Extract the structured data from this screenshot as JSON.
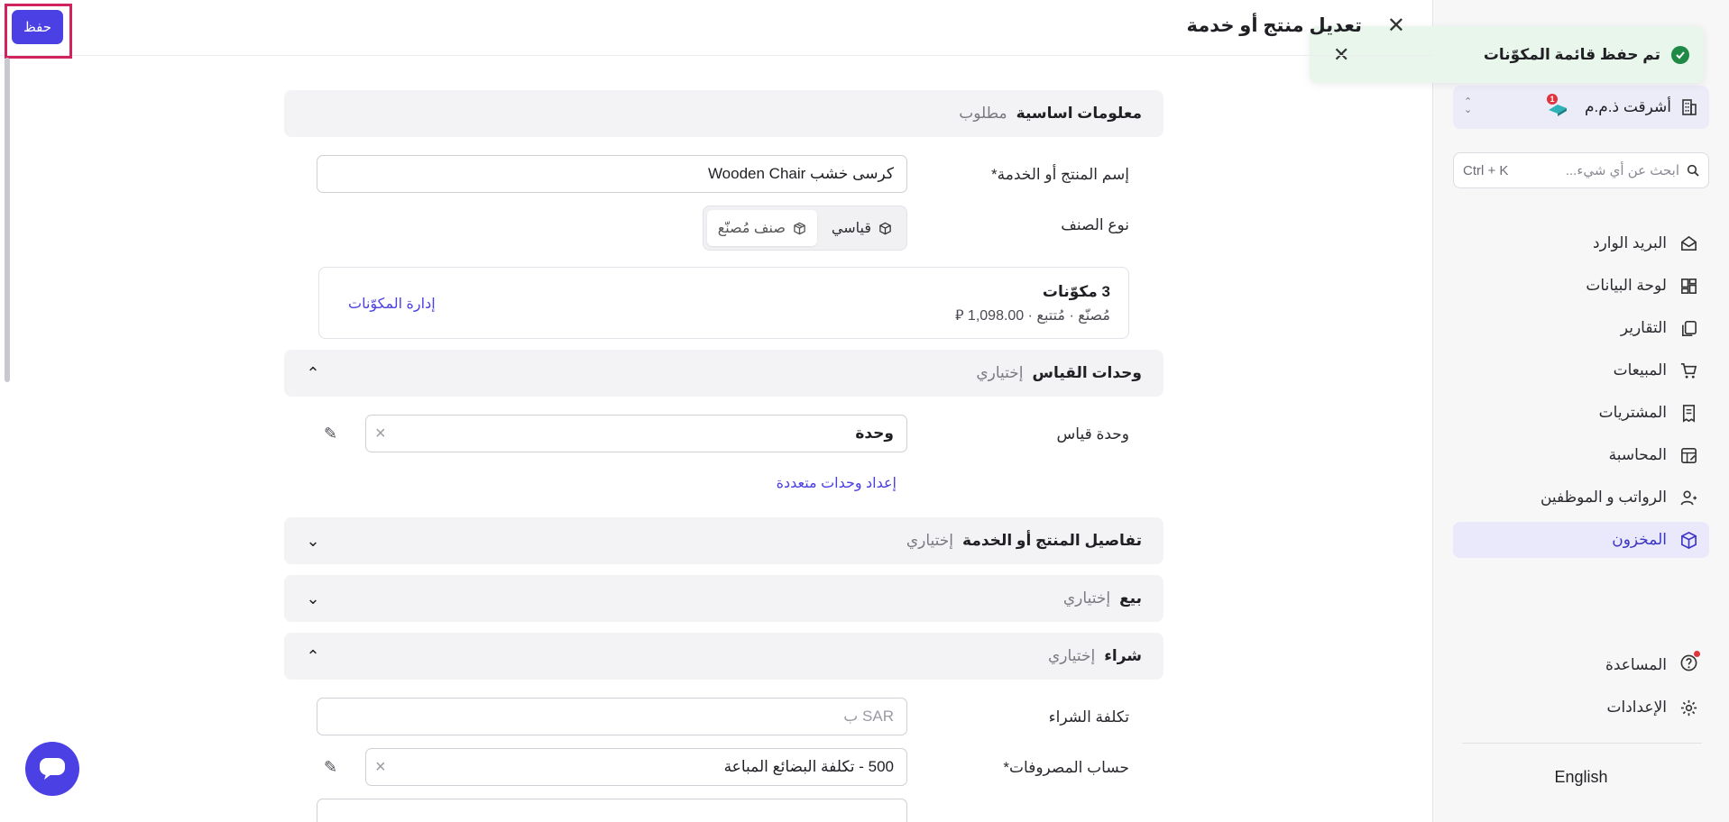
{
  "header": {
    "title": "تعديل منتج أو خدمة",
    "save_label": "حفظ"
  },
  "toast": {
    "message": "تم حفظ قائمة المكوّنات"
  },
  "sidebar": {
    "company_name": "أشرقت ذ.م.م",
    "notification_count": "1",
    "search_placeholder": "ابحث عن أي شيء...",
    "search_shortcut": "Ctrl + K",
    "items": [
      {
        "label": "البريد الوارد",
        "icon": "inbox-icon"
      },
      {
        "label": "لوحة البيانات",
        "icon": "dashboard-icon"
      },
      {
        "label": "التقارير",
        "icon": "reports-icon"
      },
      {
        "label": "المبيعات",
        "icon": "cart-icon"
      },
      {
        "label": "المشتريات",
        "icon": "receipt-icon"
      },
      {
        "label": "المحاسبة",
        "icon": "ledger-icon"
      },
      {
        "label": "الرواتب و الموظفين",
        "icon": "people-icon"
      },
      {
        "label": "المخزون",
        "icon": "box-icon",
        "active": true
      }
    ],
    "bottom_items": [
      {
        "label": "المساعدة",
        "icon": "help-icon"
      },
      {
        "label": "الإعدادات",
        "icon": "gear-icon"
      }
    ],
    "language": "English"
  },
  "form": {
    "basic": {
      "title": "معلومات اساسية",
      "subtitle": "مطلوب",
      "name_label": "إسم المنتج أو الخدمة*",
      "name_value": "كرسى خشب Wooden Chair",
      "type_label": "نوع الصنف",
      "type_options": [
        "قياسي",
        "صنف مُصنّع"
      ],
      "type_selected": "صنف مُصنّع",
      "bom_count": "3 مكوّنات",
      "bom_meta": "مُصنّع · مُتتبع · 1,098.00 ⃁",
      "bom_manage": "إدارة المكوّنات"
    },
    "units": {
      "title": "وحدات القياس",
      "subtitle": "إختياري",
      "unit_label": "وحدة قياس",
      "unit_value": "وحدة",
      "multi_link": "إعداد وحدات متعددة"
    },
    "details": {
      "title": "تفاصيل المنتج أو الخدمة",
      "subtitle": "إختياري"
    },
    "sale": {
      "title": "بيع",
      "subtitle": "إختياري"
    },
    "purchase": {
      "title": "شراء",
      "subtitle": "إختياري",
      "cost_label": "تكلفة الشراء",
      "cost_placeholder": "SAR ب",
      "expense_label": "حساب المصروفات*",
      "expense_value": "500 - تكلفة البضائع المباعة"
    }
  }
}
